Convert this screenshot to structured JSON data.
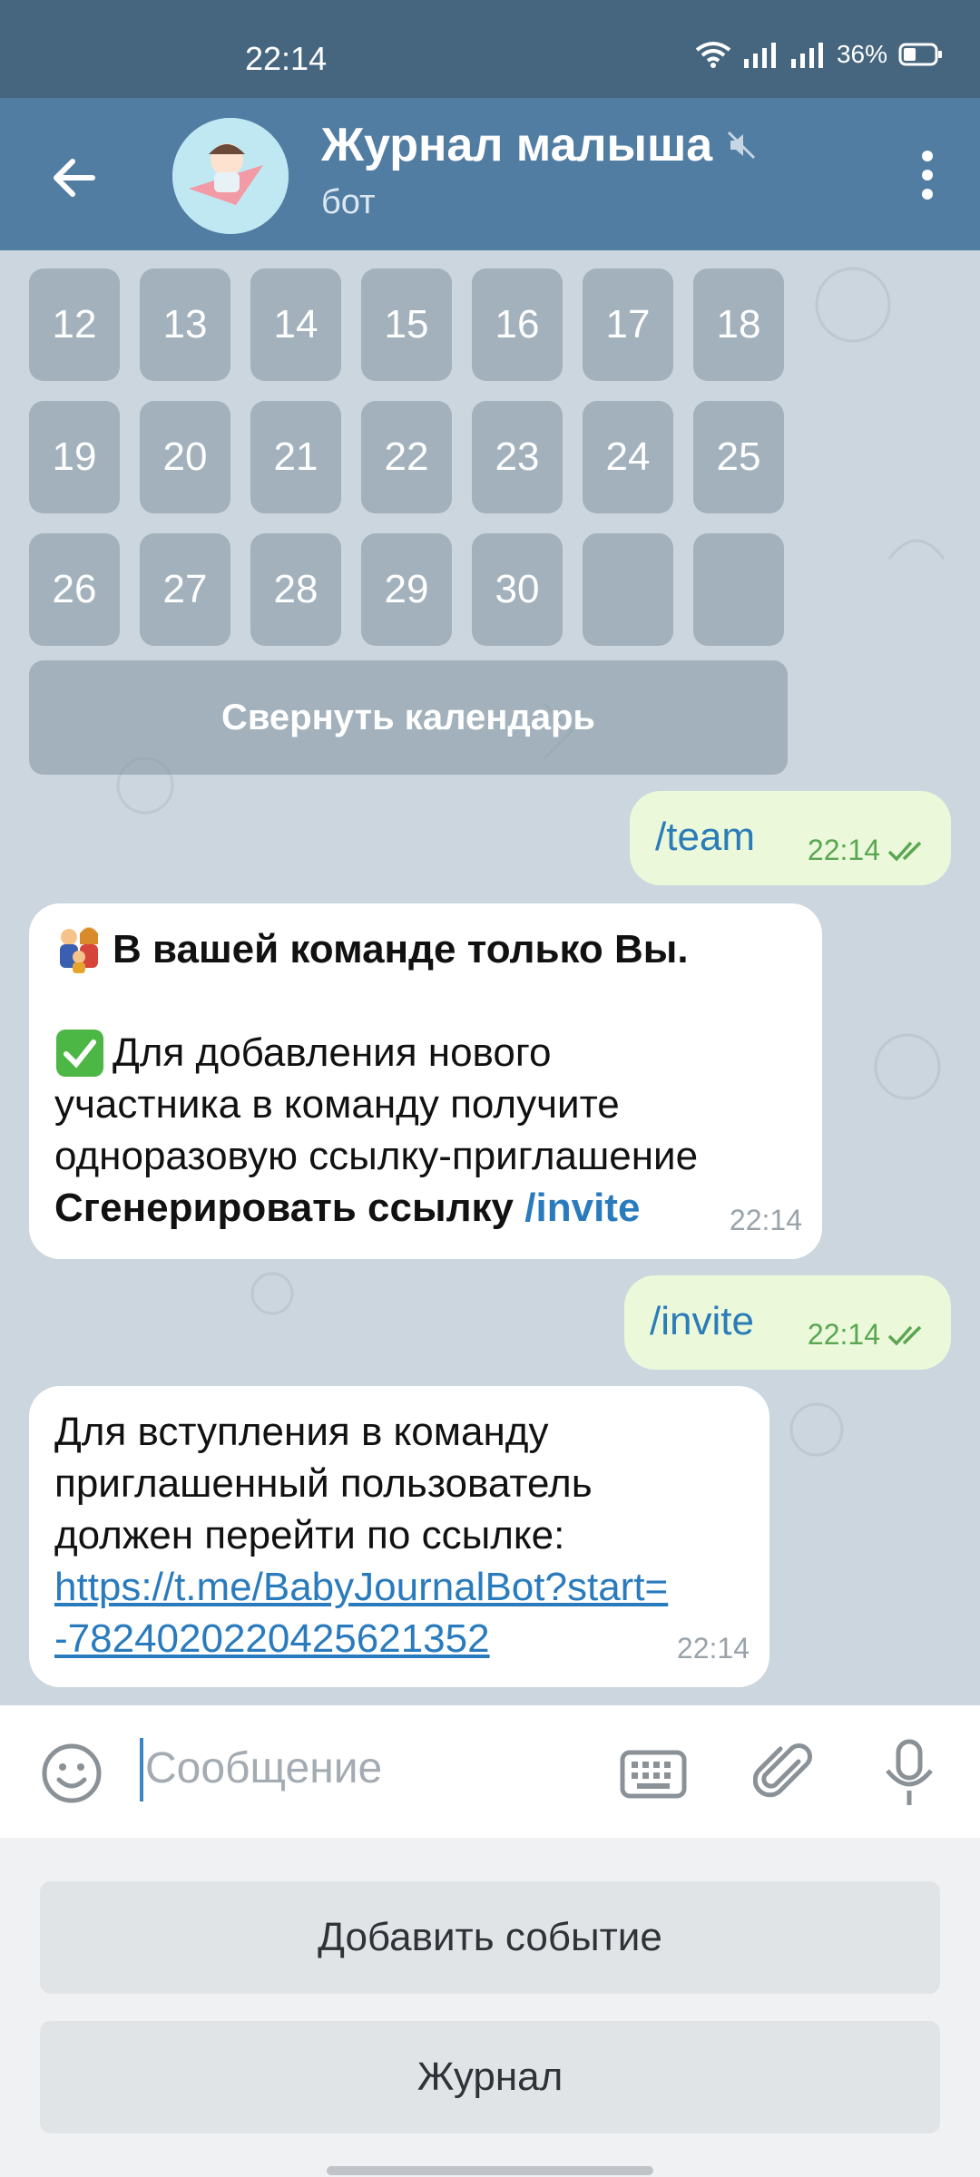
{
  "status": {
    "time": "22:14",
    "battery": "36%"
  },
  "header": {
    "title": "Журнал малыша",
    "subtitle": "бот"
  },
  "calendar": {
    "rows": [
      [
        "12",
        "13",
        "14",
        "15",
        "16",
        "17",
        "18"
      ],
      [
        "19",
        "20",
        "21",
        "22",
        "23",
        "24",
        "25"
      ],
      [
        "26",
        "27",
        "28",
        "29",
        "30",
        "",
        ""
      ]
    ],
    "collapse_label": "Свернуть календарь"
  },
  "messages": {
    "m1": {
      "text": "/team",
      "time": "22:14"
    },
    "m2": {
      "line1": "В вашей команде только Вы.",
      "line2": "Для добавления нового",
      "line3": "участника в команду получите",
      "line4": "одноразовую ссылку-приглашение",
      "line5": "Сгенерировать ссылку",
      "command": "/invite",
      "time": "22:14"
    },
    "m3": {
      "text": "/invite",
      "time": "22:14"
    },
    "m4": {
      "line1": "Для вступления в команду",
      "line2": "приглашенный пользователь",
      "line3": "должен перейти по ссылке:",
      "link1": "https://t.me/BabyJournalBot?start=",
      "link2": "-7824020220425621352",
      "time": "22:14"
    }
  },
  "input": {
    "placeholder": "Сообщение"
  },
  "keyboard": {
    "button1": "Добавить событие",
    "button2": "Журнал"
  },
  "colors": {
    "header": "#527da3",
    "statusbar": "#46667f",
    "outgoing": "#ebf9da",
    "link": "#2a7bbd"
  }
}
